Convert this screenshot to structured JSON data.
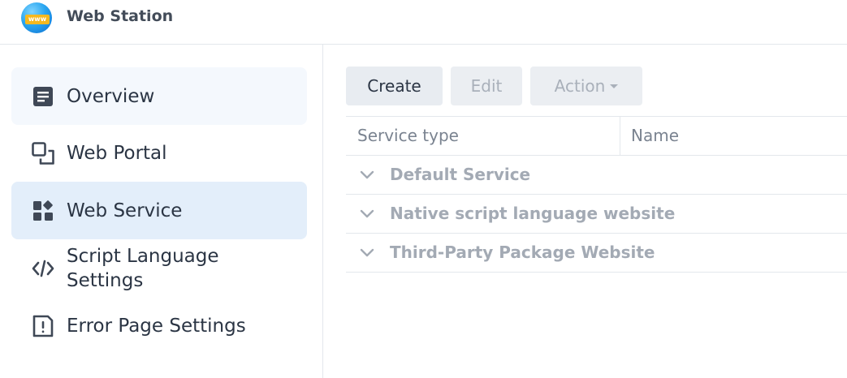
{
  "app": {
    "title": "Web Station",
    "logo_text": "www",
    "icon": "web-station-logo"
  },
  "sidebar": {
    "items": [
      {
        "label": "Overview",
        "icon": "overview-icon"
      },
      {
        "label": "Web Portal",
        "icon": "web-portal-icon"
      },
      {
        "label": "Web Service",
        "icon": "web-service-icon",
        "selected": true
      },
      {
        "label_line1": "Script Language",
        "label_line2": "Settings",
        "icon": "code-icon"
      },
      {
        "label": "Error Page Settings",
        "icon": "error-page-icon"
      }
    ]
  },
  "toolbar": {
    "create_label": "Create",
    "edit_label": "Edit",
    "action_label": "Action"
  },
  "table": {
    "columns": [
      "Service type",
      "Name"
    ],
    "groups": [
      {
        "label": "Default Service"
      },
      {
        "label": "Native script language website"
      },
      {
        "label": "Third-Party Package Website"
      }
    ]
  },
  "colors": {
    "accent_selected_bg": "#e3eefa",
    "hover_bg": "#f4f8fd",
    "text_primary": "#2b3544",
    "text_disabled": "#a9b0ba"
  }
}
